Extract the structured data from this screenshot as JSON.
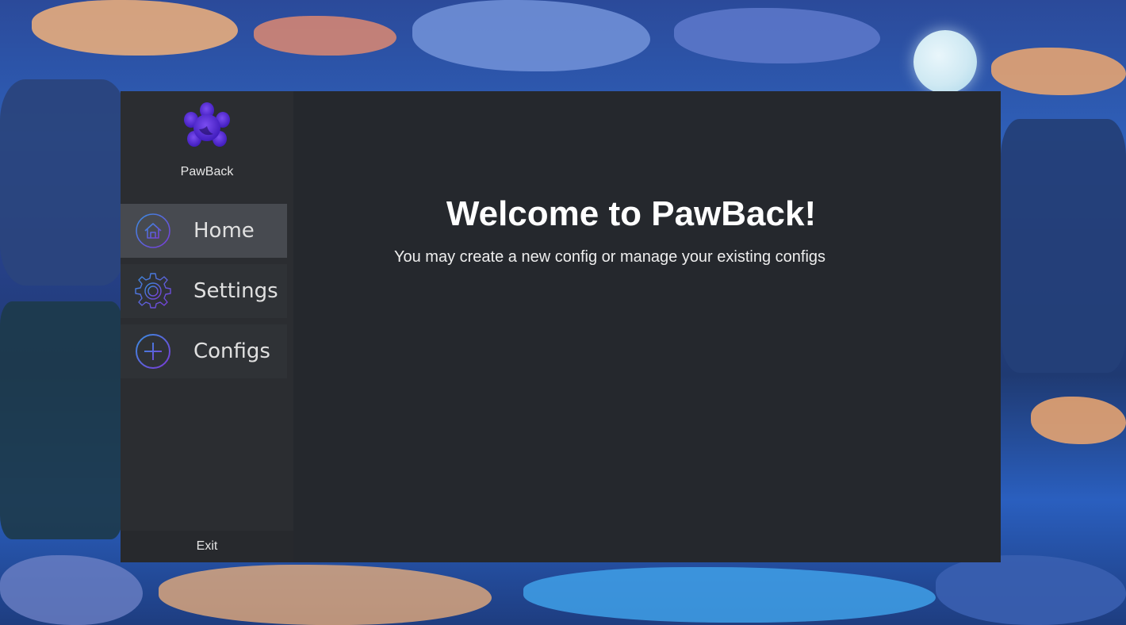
{
  "brand": {
    "name": "PawBack",
    "logo_icon": "paw-logo-icon",
    "logo_color": "#5b2ad6"
  },
  "nav": {
    "items": [
      {
        "label": "Home",
        "icon": "home-icon",
        "active": true
      },
      {
        "label": "Settings",
        "icon": "gear-icon",
        "active": false
      },
      {
        "label": "Configs",
        "icon": "plus-circle-icon",
        "active": false
      }
    ],
    "exit_label": "Exit"
  },
  "main": {
    "title": "Welcome to PawBack!",
    "subtitle": "You may create a new config or manage your existing configs"
  },
  "colors": {
    "window_bg": "#25282d",
    "sidebar_bg": "#2b2d31",
    "active_item_bg": "#474a50",
    "icon_gradient_start": "#3a8ee0",
    "icon_gradient_end": "#7a3ad6"
  }
}
